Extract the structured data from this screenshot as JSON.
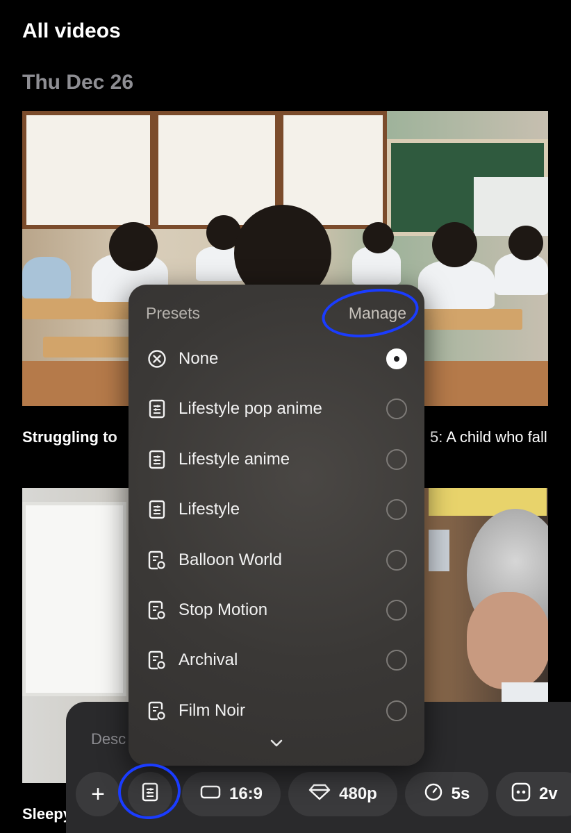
{
  "header": {
    "title": "All videos"
  },
  "feed": {
    "date": "Thu Dec 26",
    "videos": [
      {
        "title_left": "Struggling to",
        "title_right": "5: A child who fall"
      },
      {
        "title_left": "Sleepy"
      }
    ]
  },
  "composer": {
    "placeholder": "Desc",
    "toolbar": {
      "add_label": "+",
      "aspect_label": "16:9",
      "quality_label": "480p",
      "duration_label": "5s",
      "variants_label": "2v"
    }
  },
  "presets_menu": {
    "header": "Presets",
    "manage_label": "Manage",
    "items": [
      {
        "label": "None",
        "icon": "x-circle-icon",
        "selected": true
      },
      {
        "label": "Lifestyle pop anime",
        "icon": "sliders-doc-icon",
        "selected": false
      },
      {
        "label": "Lifestyle anime",
        "icon": "sliders-doc-icon",
        "selected": false
      },
      {
        "label": "Lifestyle",
        "icon": "sliders-doc-icon",
        "selected": false
      },
      {
        "label": "Balloon World",
        "icon": "custom-preset-icon",
        "selected": false
      },
      {
        "label": "Stop Motion",
        "icon": "custom-preset-icon",
        "selected": false
      },
      {
        "label": "Archival",
        "icon": "custom-preset-icon",
        "selected": false
      },
      {
        "label": "Film Noir",
        "icon": "custom-preset-icon",
        "selected": false
      }
    ]
  },
  "annotations": {
    "color": "#1a3cff"
  },
  "colors": {
    "background": "#000000",
    "panel": "#2a2a2c",
    "pill": "#3a3a3c"
  }
}
